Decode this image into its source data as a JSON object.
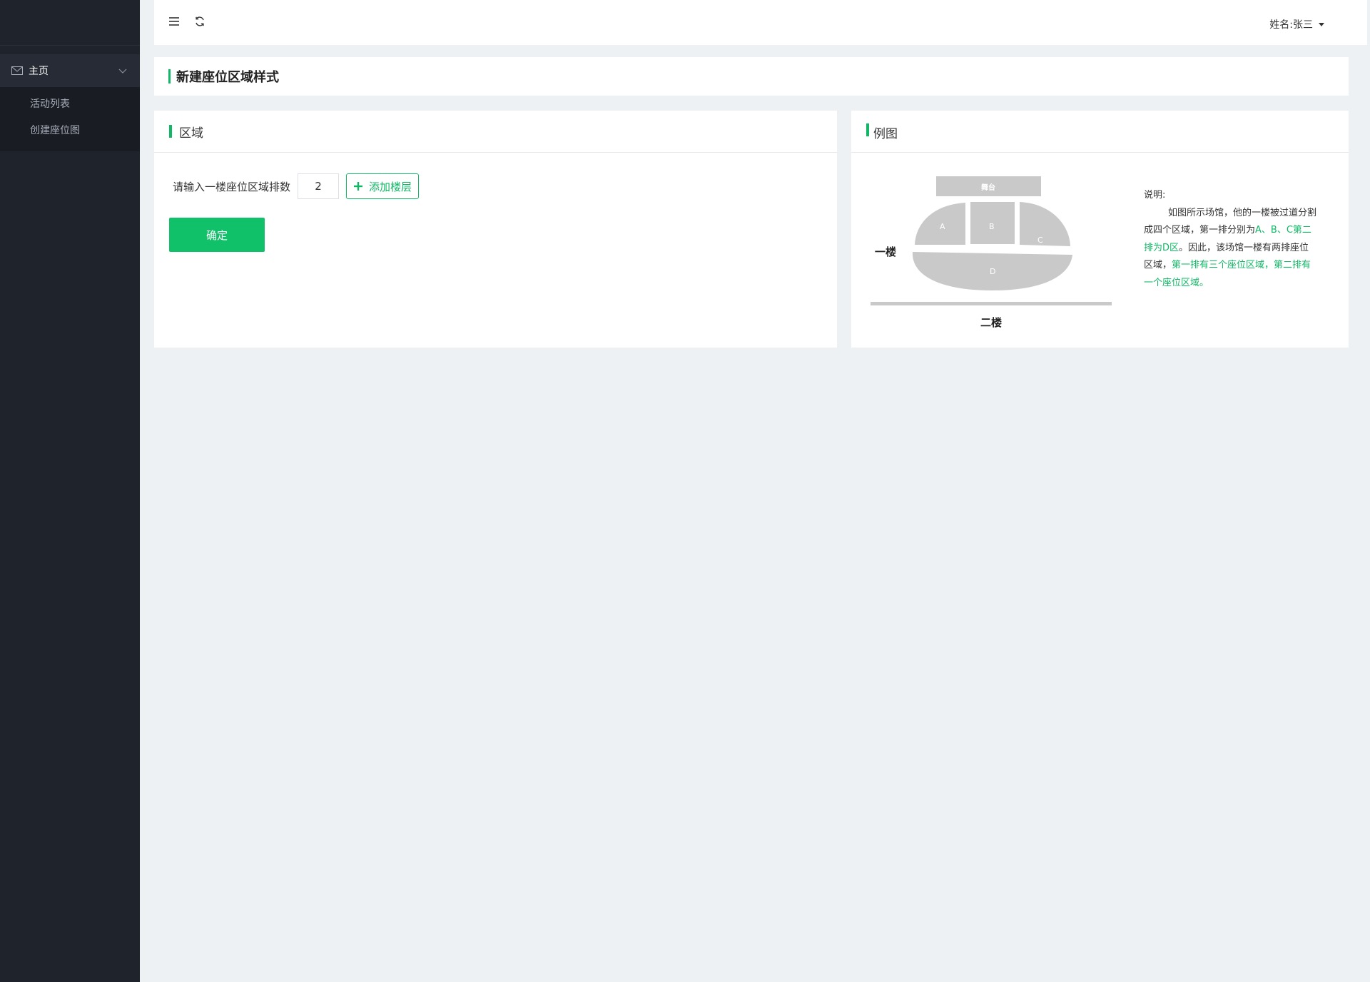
{
  "sidebar": {
    "menu_head": "主页",
    "items": [
      {
        "label": "活动列表"
      },
      {
        "label": "创建座位图"
      }
    ]
  },
  "topbar": {
    "user_label": "姓名:张三"
  },
  "page": {
    "title": "新建座位区域样式"
  },
  "area_panel": {
    "title": "区域",
    "input_label": "请输入一楼座位区域排数",
    "input_value": "2",
    "add_floor_label": "添加楼层",
    "confirm_label": "确定"
  },
  "example_panel": {
    "title": "例图",
    "diagram": {
      "stage_label": "舞台",
      "floor1_label": "一楼",
      "floor2_label": "二楼",
      "zones": [
        "A",
        "B",
        "C",
        "D"
      ]
    },
    "explanation": {
      "heading": "说明:",
      "part1": "如图所示场馆，他的一楼被过道分割成四个区域，第一排分别为",
      "part2_green": "A、B、C第二排为D区",
      "part3": "。因此，该场馆一楼有两排座位区域，",
      "part4_green": "第一排有三个座位区域，第二排有一个座位区域。"
    }
  },
  "colors": {
    "accent": "#10b865",
    "sidebar_bg": "#1f232c",
    "page_bg": "#edf1f3",
    "diagram_gray": "#c9c9c9"
  }
}
